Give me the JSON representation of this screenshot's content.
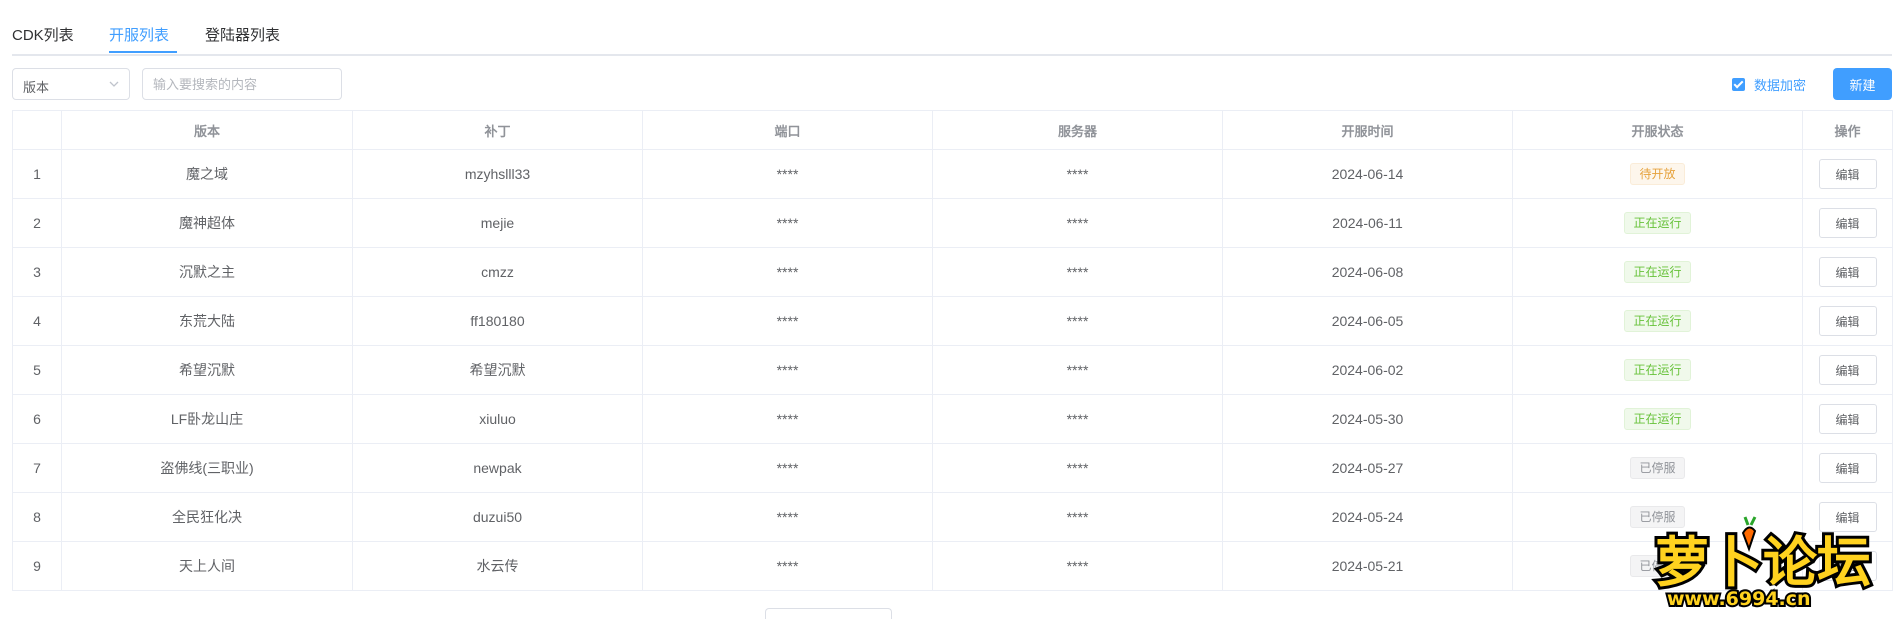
{
  "tabs": [
    {
      "label": "CDK列表",
      "active": false
    },
    {
      "label": "开服列表",
      "active": true
    },
    {
      "label": "登陆器列表",
      "active": false
    }
  ],
  "toolbar": {
    "select_value": "版本",
    "search_placeholder": "输入要搜索的内容",
    "encrypt_label": "数据加密",
    "encrypt_checked": true,
    "new_button": "新建"
  },
  "table": {
    "headers": [
      "",
      "版本",
      "补丁",
      "端口",
      "服务器",
      "开服时间",
      "开服状态",
      "操作"
    ],
    "edit_label": "编辑",
    "rows": [
      {
        "index": "1",
        "version": "魔之域",
        "patch": "mzyhslll33",
        "port": "****",
        "server": "****",
        "date": "2024-06-14",
        "status": "待开放",
        "status_type": "pending"
      },
      {
        "index": "2",
        "version": "魔神超体",
        "patch": "mejie",
        "port": "****",
        "server": "****",
        "date": "2024-06-11",
        "status": "正在运行",
        "status_type": "running"
      },
      {
        "index": "3",
        "version": "沉默之主",
        "patch": "cmzz",
        "port": "****",
        "server": "****",
        "date": "2024-06-08",
        "status": "正在运行",
        "status_type": "running"
      },
      {
        "index": "4",
        "version": "东荒大陆",
        "patch": "ff180180",
        "port": "****",
        "server": "****",
        "date": "2024-06-05",
        "status": "正在运行",
        "status_type": "running"
      },
      {
        "index": "5",
        "version": "希望沉默",
        "patch": "希望沉默",
        "port": "****",
        "server": "****",
        "date": "2024-06-02",
        "status": "正在运行",
        "status_type": "running"
      },
      {
        "index": "6",
        "version": "LF卧龙山庄",
        "patch": "xiuluo",
        "port": "****",
        "server": "****",
        "date": "2024-05-30",
        "status": "正在运行",
        "status_type": "running"
      },
      {
        "index": "7",
        "version": "盗佛线(三职业)",
        "patch": "newpak",
        "port": "****",
        "server": "****",
        "date": "2024-05-27",
        "status": "已停服",
        "status_type": "stopped"
      },
      {
        "index": "8",
        "version": "全民狂化决",
        "patch": "duzui50",
        "port": "****",
        "server": "****",
        "date": "2024-05-24",
        "status": "已停服",
        "status_type": "stopped"
      },
      {
        "index": "9",
        "version": "天上人间",
        "patch": "水云传",
        "port": "****",
        "server": "****",
        "date": "2024-05-21",
        "status": "已停服",
        "status_type": "stopped"
      }
    ]
  },
  "watermark": {
    "title": "萝卜论坛",
    "url": "www.6994.cn"
  },
  "colors": {
    "primary": "#409eff",
    "pending": "#e6a23c",
    "running": "#67c23a",
    "stopped": "#909399"
  }
}
